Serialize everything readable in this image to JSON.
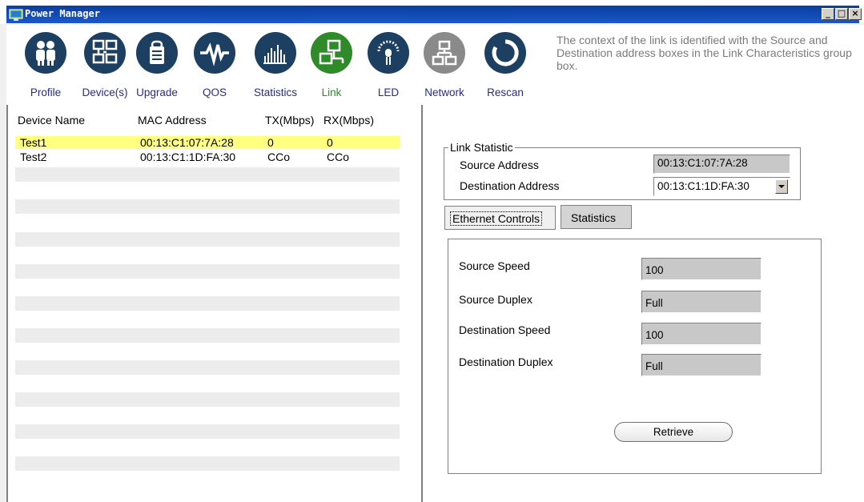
{
  "window": {
    "title": "Power Manager"
  },
  "toolbar": {
    "items": [
      {
        "label": "Profile",
        "icon": "people-icon",
        "color": "#1d3f62"
      },
      {
        "label": "Device(s)",
        "icon": "devices-icon",
        "color": "#1d3f62"
      },
      {
        "label": "Upgrade",
        "icon": "upgrade-icon",
        "color": "#1d3f62"
      },
      {
        "label": "QOS",
        "icon": "pulse-icon",
        "color": "#1d3f62"
      },
      {
        "label": "Statistics",
        "icon": "bar-chart-icon",
        "color": "#1d3f62"
      },
      {
        "label": "Link",
        "icon": "link-icon",
        "color": "#2f8a2a",
        "active": true
      },
      {
        "label": "LED",
        "icon": "led-icon",
        "color": "#1d3f62"
      },
      {
        "label": "Network",
        "icon": "network-icon",
        "color": "#8a8a8a"
      },
      {
        "label": "Rescan",
        "icon": "rescan-icon",
        "color": "#1d3f62"
      }
    ],
    "info": "The context of the link is identified with the Source and Destination address boxes in the Link Characteristics group box."
  },
  "device_table": {
    "columns": [
      "Device Name",
      "MAC Address",
      "TX(Mbps)",
      "RX(Mbps)"
    ],
    "rows": [
      {
        "name": "Test1",
        "mac": "00:13:C1:07:7A:28",
        "tx": "0",
        "rx": "0",
        "selected": true
      },
      {
        "name": "Test2",
        "mac": "00:13:C1:1D:FA:30",
        "tx": "CCo",
        "rx": "CCo",
        "selected": false
      }
    ]
  },
  "link_statistic": {
    "group_label": "Link Statistic",
    "source_label": "Source Address",
    "source_value": "00:13:C1:07:7A:28",
    "destination_label": "Destination Address",
    "destination_value": "00:13:C1:1D:FA:30"
  },
  "tabs": [
    {
      "label": "Ethernet Controls",
      "active": true
    },
    {
      "label": "Statistics",
      "active": false
    }
  ],
  "ethernet": {
    "source_speed_label": "Source Speed",
    "source_speed": "100",
    "source_duplex_label": "Source Duplex",
    "source_duplex": "Full",
    "dest_speed_label": "Destination Speed",
    "dest_speed": "100",
    "dest_duplex_label": "Destination Duplex",
    "dest_duplex": "Full",
    "retrieve_label": "Retrieve"
  }
}
